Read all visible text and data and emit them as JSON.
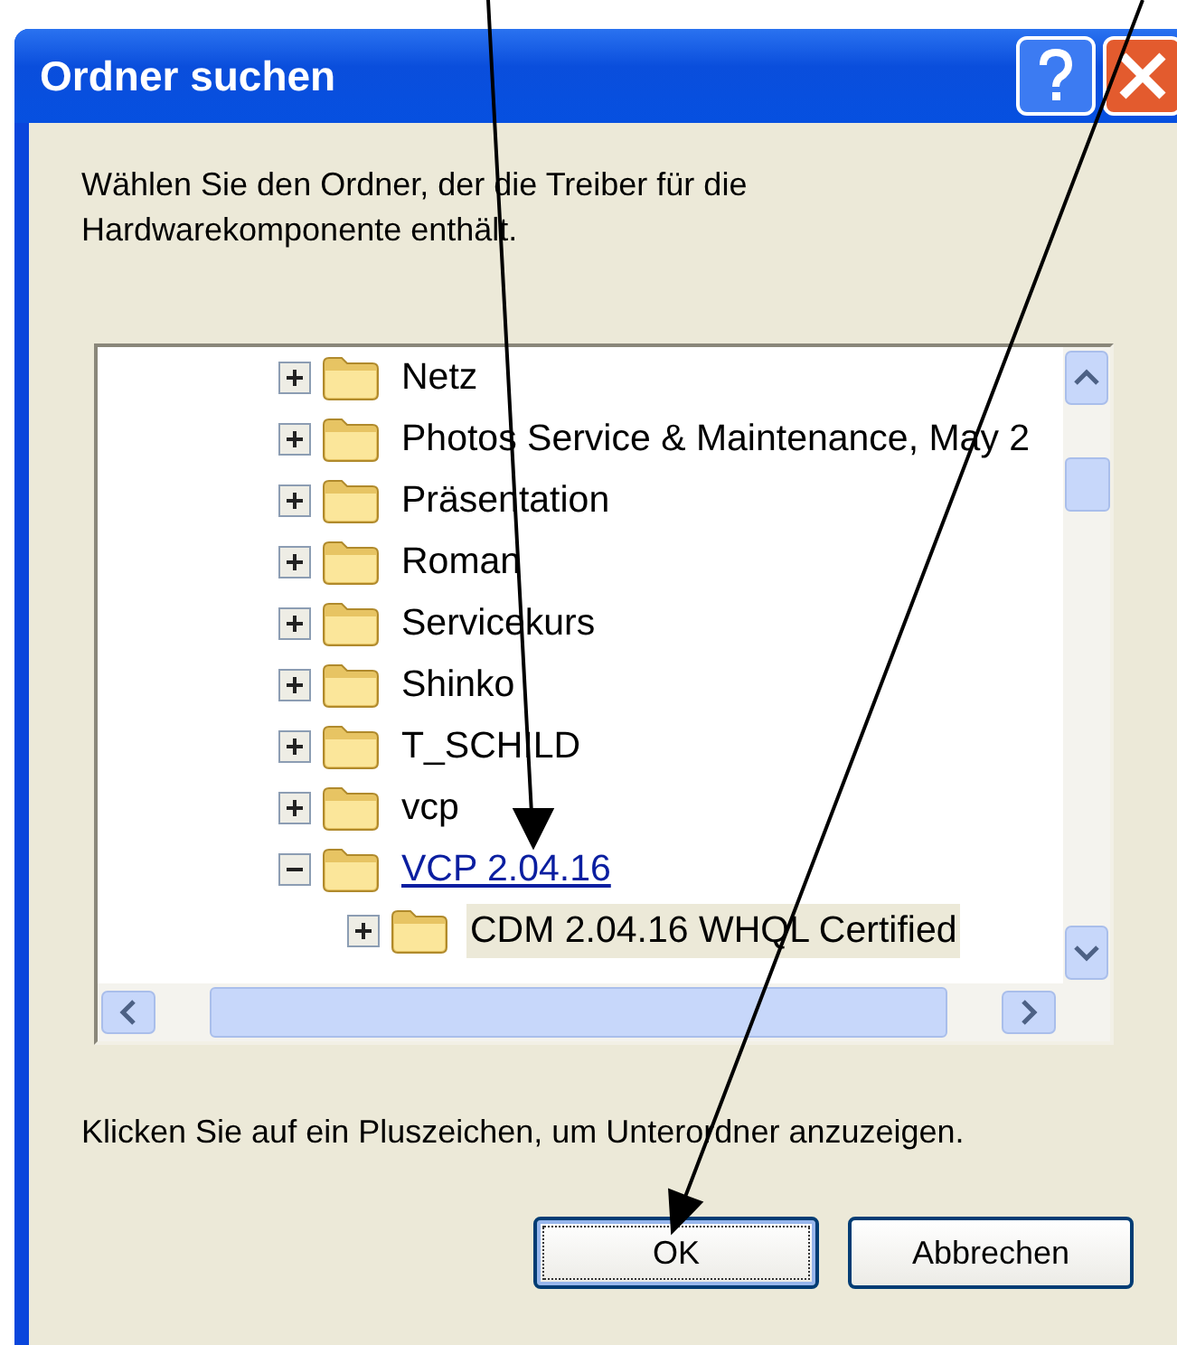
{
  "window": {
    "title": "Ordner suchen"
  },
  "instruction": "Wählen Sie den Ordner, der die Treiber für die Hardwarekomponente enthält.",
  "tree": {
    "items": [
      {
        "label": "Netz",
        "expanded": false,
        "selected": false,
        "hovered": false
      },
      {
        "label": "Photos Service & Maintenance, May 2",
        "expanded": false,
        "selected": false,
        "hovered": false
      },
      {
        "label": "Präsentation",
        "expanded": false,
        "selected": false,
        "hovered": false
      },
      {
        "label": "Roman",
        "expanded": false,
        "selected": false,
        "hovered": false
      },
      {
        "label": "Servicekurs",
        "expanded": false,
        "selected": false,
        "hovered": false
      },
      {
        "label": "Shinko",
        "expanded": false,
        "selected": false,
        "hovered": false
      },
      {
        "label": "T_SCHILD",
        "expanded": false,
        "selected": false,
        "hovered": false
      },
      {
        "label": "vcp",
        "expanded": false,
        "selected": false,
        "hovered": false
      },
      {
        "label": "VCP 2.04.16",
        "expanded": true,
        "selected": false,
        "hovered": true,
        "children": [
          {
            "label": "CDM 2.04.16 WHQL Certified",
            "expanded": false,
            "selected": true,
            "hovered": false
          }
        ]
      }
    ]
  },
  "hint": "Klicken Sie auf ein Pluszeichen, um Unterordner anzuzeigen.",
  "buttons": [
    {
      "label": "OK",
      "default": true
    },
    {
      "label": "Abbrechen",
      "default": false
    }
  ]
}
